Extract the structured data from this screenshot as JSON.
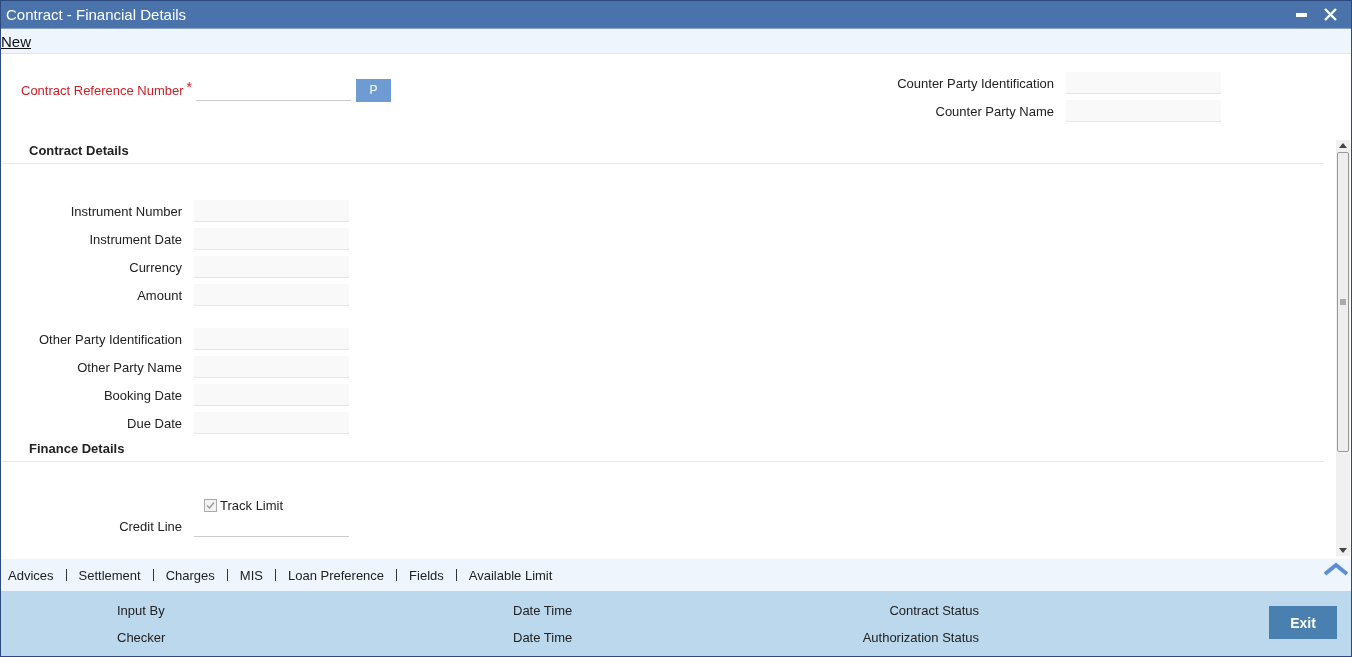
{
  "window": {
    "title": "Contract - Financial Details"
  },
  "menu": [
    {
      "label": "New"
    }
  ],
  "header": {
    "reference": {
      "label": "Contract Reference Number",
      "required": "*",
      "button": "P"
    },
    "counter_party": [
      {
        "label": "Counter Party Identification"
      },
      {
        "label": "Counter Party Name"
      }
    ]
  },
  "sections": [
    {
      "title": "Contract Details",
      "groups": [
        [
          {
            "label": "Instrument Number",
            "kind": "box"
          },
          {
            "label": "Instrument Date",
            "kind": "box"
          },
          {
            "label": "Currency",
            "kind": "box"
          },
          {
            "label": "Amount",
            "kind": "box"
          }
        ],
        [
          {
            "label": "Other Party Identification",
            "kind": "box"
          },
          {
            "label": "Other Party Name",
            "kind": "box"
          },
          {
            "label": "Booking Date",
            "kind": "box"
          },
          {
            "label": "Due Date",
            "kind": "box"
          }
        ]
      ]
    },
    {
      "title": "Finance Details",
      "groups": [
        [
          {
            "label": "Track Limit",
            "kind": "checkbox",
            "checked": true,
            "disabled": true
          },
          {
            "label": "Credit Line",
            "kind": "line"
          }
        ]
      ]
    }
  ],
  "tabs": [
    {
      "label": "Advices"
    },
    {
      "label": "Settlement"
    },
    {
      "label": "Charges"
    },
    {
      "label": "MIS"
    },
    {
      "label": "Loan Preference"
    },
    {
      "label": "Fields"
    },
    {
      "label": "Available Limit"
    }
  ],
  "audit": [
    [
      "Input By",
      "Checker"
    ],
    [
      "Date Time",
      "Date Time"
    ],
    [
      "Contract Status",
      "Authorization Status"
    ]
  ],
  "exit_button": "Exit"
}
